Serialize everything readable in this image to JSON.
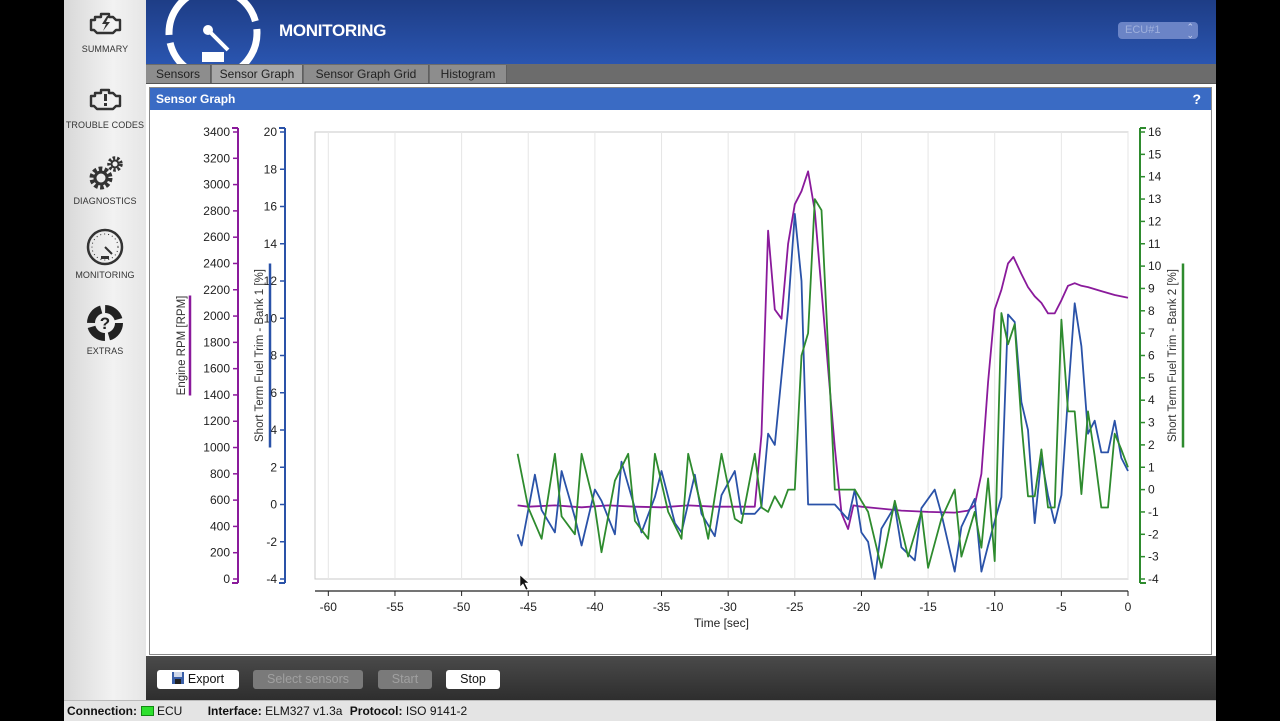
{
  "app": {
    "section_title": "MONITORING",
    "ecu_selector": {
      "selected": "ECU#1"
    }
  },
  "sidebar": {
    "items": [
      {
        "label": "SUMMARY",
        "icon": "engine-bolt-icon"
      },
      {
        "label": "TROUBLE CODES",
        "icon": "engine-warning-icon"
      },
      {
        "label": "DIAGNOSTICS",
        "icon": "gears-icon"
      },
      {
        "label": "MONITORING",
        "icon": "gauge-icon"
      },
      {
        "label": "EXTRAS",
        "icon": "help-lifebuoy-icon"
      }
    ]
  },
  "tabs": [
    {
      "label": "Sensors",
      "active": false
    },
    {
      "label": "Sensor Graph",
      "active": true
    },
    {
      "label": "Sensor Graph Grid",
      "active": false
    },
    {
      "label": "Histogram",
      "active": false
    }
  ],
  "panel": {
    "title": "Sensor Graph",
    "help": "?"
  },
  "footer": {
    "export_label": "Export",
    "select_sensors_label": "Select sensors",
    "start_label": "Start",
    "stop_label": "Stop"
  },
  "status": {
    "connection_label": "Connection:",
    "connection_value": "ECU",
    "connection_color": "#2ee02e",
    "interface_label": "Interface:",
    "interface_value": "ELM327 v1.3a",
    "protocol_label": "Protocol:",
    "protocol_value": "ISO 9141-2"
  },
  "chart_data": {
    "type": "line",
    "title": "Sensor Graph",
    "xlabel": "Time [sec]",
    "xlim": [
      -61,
      0
    ],
    "x_ticks": [
      -60,
      -55,
      -50,
      -45,
      -40,
      -35,
      -30,
      -25,
      -20,
      -15,
      -10,
      -5,
      0
    ],
    "grid": true,
    "axes": [
      {
        "id": "rpm",
        "label": "Engine RPM [RPM]",
        "side": "left-outer",
        "color": "#8a1a9b",
        "ylim": [
          0,
          3400
        ],
        "ticks": [
          0,
          200,
          400,
          600,
          800,
          1000,
          1200,
          1400,
          1600,
          1800,
          2000,
          2200,
          2400,
          2600,
          2800,
          3000,
          3200,
          3400
        ]
      },
      {
        "id": "b1",
        "label": "Short Term Fuel Trim - Bank 1 [%]",
        "side": "left-inner",
        "color": "#2a52a8",
        "ylim": [
          -4,
          20
        ],
        "ticks": [
          -4,
          -2,
          0,
          2,
          4,
          6,
          8,
          10,
          12,
          14,
          16,
          18,
          20
        ]
      },
      {
        "id": "b2",
        "label": "Short Term Fuel Trim - Bank 2 [%]",
        "side": "right",
        "color": "#2e8b2e",
        "ylim": [
          -4,
          16
        ],
        "ticks": [
          -4,
          -3,
          -2,
          -1,
          0,
          1,
          2,
          3,
          4,
          5,
          6,
          7,
          8,
          9,
          10,
          11,
          12,
          13,
          14,
          15,
          16
        ]
      }
    ],
    "series": [
      {
        "name": "Engine RPM",
        "axis": "rpm",
        "color": "#8a1a9b",
        "x": [
          -45.8,
          -45,
          -43,
          -41,
          -39,
          -37,
          -35,
          -33,
          -31,
          -29,
          -28,
          -27.5,
          -27,
          -26.5,
          -26,
          -25.5,
          -25,
          -24.5,
          -24,
          -23.5,
          -23,
          -22.5,
          -22,
          -21.5,
          -21,
          -20.6,
          -20,
          -19,
          -17,
          -15,
          -13,
          -12,
          -11.5,
          -11,
          -10.5,
          -10,
          -9.5,
          -9,
          -8.6,
          -8,
          -7.5,
          -7,
          -6.5,
          -6,
          -5.5,
          -5,
          -4.5,
          -4,
          -3.5,
          -3,
          -2,
          -1,
          0
        ],
        "y": [
          560,
          550,
          560,
          545,
          560,
          550,
          545,
          560,
          550,
          550,
          550,
          1100,
          2650,
          2050,
          1980,
          2550,
          2850,
          2950,
          3100,
          2800,
          2200,
          1600,
          1000,
          500,
          380,
          560,
          550,
          540,
          520,
          510,
          505,
          520,
          560,
          800,
          1500,
          2050,
          2200,
          2400,
          2450,
          2320,
          2220,
          2150,
          2100,
          2020,
          2020,
          2120,
          2230,
          2250,
          2230,
          2220,
          2190,
          2160,
          2140
        ]
      },
      {
        "name": "Short Term Fuel Trim - Bank 1",
        "axis": "b1",
        "color": "#2a52a8",
        "x": [
          -45.8,
          -45.5,
          -44.5,
          -44,
          -43,
          -42.5,
          -41.5,
          -41,
          -40,
          -39.5,
          -38.5,
          -38,
          -37,
          -36.5,
          -35.5,
          -35,
          -34,
          -33.5,
          -32.5,
          -32,
          -31,
          -30.5,
          -29.5,
          -29,
          -28,
          -27.5,
          -27,
          -26.5,
          -25.5,
          -25,
          -24.5,
          -24,
          -23,
          -22,
          -21,
          -20.5,
          -20,
          -19.5,
          -19,
          -18.5,
          -17.5,
          -17,
          -16,
          -15.5,
          -14.5,
          -14,
          -13,
          -12.5,
          -11.5,
          -11,
          -10.5,
          -10,
          -9.5,
          -9,
          -8.5,
          -8,
          -7.5,
          -7,
          -6.5,
          -6,
          -5.5,
          -5,
          -4.5,
          -4,
          -3.5,
          -3,
          -2.5,
          -2,
          -1.5,
          -1,
          -0.5,
          0
        ],
        "y": [
          -1.6,
          -2.2,
          1.6,
          -0.3,
          -1.5,
          1.8,
          -0.7,
          -2.2,
          0.8,
          0.2,
          -1.6,
          2.3,
          -0.2,
          -1.5,
          0.4,
          1.8,
          -1.0,
          -1.5,
          1.6,
          -0.5,
          -1.7,
          0.5,
          1.8,
          -0.5,
          -0.5,
          -0.1,
          3.8,
          3.2,
          10.5,
          15.6,
          12,
          0,
          0,
          0,
          -0.8,
          0.8,
          -1.5,
          -2,
          -4,
          -1.3,
          -0.1,
          -2.3,
          -3,
          -0.2,
          0.8,
          -0.5,
          -3.6,
          -1.2,
          0.3,
          -3.6,
          -2.2,
          -0.9,
          0.4,
          10.2,
          9.8,
          5.5,
          4,
          -1,
          2.5,
          0.5,
          -1,
          0.5,
          5.8,
          10.8,
          8.5,
          3.8,
          4.5,
          2.8,
          2.8,
          4.5,
          2.5,
          1.8
        ]
      },
      {
        "name": "Short Term Fuel Trim - Bank 2",
        "axis": "b2",
        "color": "#2e8b2e",
        "x": [
          -45.8,
          -45,
          -44,
          -43,
          -42.5,
          -41.5,
          -41,
          -40,
          -39.5,
          -38.5,
          -37.5,
          -37,
          -36,
          -35.5,
          -34.5,
          -33.5,
          -33,
          -32,
          -31.5,
          -30.5,
          -29.5,
          -29,
          -28,
          -27.5,
          -27,
          -26.5,
          -26,
          -25.5,
          -25,
          -24.5,
          -24,
          -23.5,
          -23,
          -22,
          -21,
          -20.5,
          -20,
          -19.5,
          -18.5,
          -17.5,
          -16.5,
          -15.5,
          -15,
          -14,
          -13,
          -12.5,
          -11.5,
          -11,
          -10.5,
          -10,
          -9.5,
          -9,
          -8.5,
          -8,
          -7.5,
          -7,
          -6.5,
          -6,
          -5.5,
          -5,
          -4.5,
          -4,
          -3.5,
          -3,
          -2.5,
          -2,
          -1.5,
          -1,
          -0.5,
          0
        ],
        "y": [
          1.6,
          -0.8,
          -2.2,
          1.6,
          -1.2,
          -2,
          1.6,
          -0.8,
          -2.8,
          0.4,
          1.6,
          -1.4,
          -2.2,
          1.6,
          -1.0,
          -2.2,
          1.6,
          -0.8,
          -2.2,
          1.6,
          -1.3,
          -1.5,
          1.6,
          -0.8,
          -1,
          -0.3,
          -0.8,
          0,
          0,
          6,
          7,
          13,
          12.5,
          0,
          0,
          0,
          -0.5,
          -1.0,
          -3.5,
          -0.5,
          -3,
          -1.0,
          -3.5,
          -1.3,
          0,
          -3,
          -1.0,
          -2.6,
          0.5,
          -3.2,
          7.9,
          6.5,
          7.4,
          3,
          -0.3,
          -0.3,
          1.8,
          -0.8,
          -0.8,
          7.6,
          3.5,
          3.5,
          -0.2,
          3.5,
          1.5,
          -0.8,
          -0.8,
          2.5,
          1.8,
          1
        ]
      }
    ]
  }
}
